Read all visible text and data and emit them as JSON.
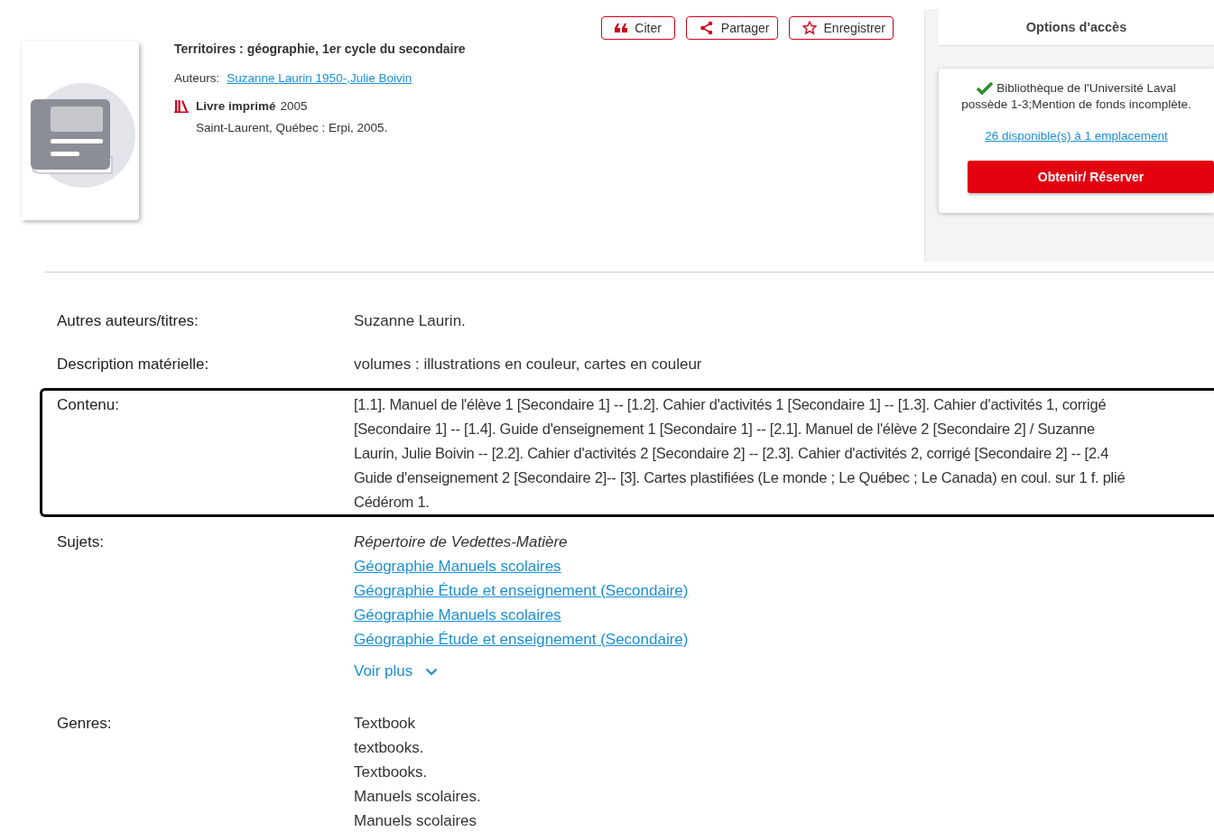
{
  "actions": [
    {
      "kind": "cite",
      "label": "Citer"
    },
    {
      "kind": "share",
      "label": "Partager"
    },
    {
      "kind": "save",
      "label": "Enregistrer"
    }
  ],
  "record": {
    "title": "Territoires : géographie, 1er cycle du secondaire",
    "authors_label": "Auteurs:",
    "authors": [
      "Suzanne Laurin 1950-",
      "Julie Boivin"
    ],
    "author_separator": ",",
    "format": "Livre imprimé",
    "year": "2005",
    "publication": "Saint-Laurent, Québec : Erpi, 2005."
  },
  "access": {
    "title": "Options d'accès",
    "library": "Bibliothèque de l'Université Laval",
    "holdings": "possède 1-3;Mention de fonds incomplète.",
    "availability": "26 disponible(s) à 1 emplacement",
    "button": "Obtenir/ Réserver"
  },
  "details": [
    {
      "label": "Autres auteurs/titres:",
      "highlighted": false,
      "items": [
        {
          "kind": "text",
          "text": "Suzanne Laurin."
        }
      ]
    },
    {
      "label": "Description matérielle:",
      "highlighted": false,
      "items": [
        {
          "kind": "text",
          "text": "volumes : illustrations en couleur, cartes en couleur"
        }
      ]
    },
    {
      "label": "Contenu:",
      "highlighted": true,
      "items": [
        {
          "kind": "paragraph",
          "lines": [
            "[1.1]. Manuel de l'élève 1 [Secondaire 1] -- [1.2]. Cahier d'activités 1 [Secondaire 1] -- [1.3]. Cahier d'activités 1, corrigé",
            "[Secondaire 1] -- [1.4]. Guide d'enseignement 1 [Secondaire 1] -- [2.1]. Manuel de l'élève 2 [Secondaire 2] / Suzanne",
            "Laurin, Julie Boivin -- [2.2]. Cahier d'activités 2 [Secondaire 2] -- [2.3]. Cahier d'activités 2, corrigé [Secondaire 2] -- [2.4",
            "Guide d'enseignement 2 [Secondaire 2]-- [3]. Cartes plastifiées (Le monde ; Le Québec ; Le Canada) en coul. sur 1 f. plié",
            "Cédérom 1."
          ]
        }
      ]
    },
    {
      "label": "Sujets:",
      "highlighted": false,
      "items": [
        {
          "kind": "heading",
          "text": "Répertoire de Vedettes-Matière"
        },
        {
          "kind": "link",
          "text": "Géographie Manuels scolaires"
        },
        {
          "kind": "link",
          "text": "Géographie Étude et enseignement (Secondaire)"
        },
        {
          "kind": "link",
          "text": "Géographie Manuels scolaires"
        },
        {
          "kind": "link",
          "text": "Géographie Étude et enseignement (Secondaire)"
        },
        {
          "kind": "more",
          "text": "Voir plus"
        }
      ]
    },
    {
      "label": "Genres:",
      "highlighted": false,
      "items": [
        {
          "kind": "text",
          "text": "Textbook"
        },
        {
          "kind": "text",
          "text": "textbooks."
        },
        {
          "kind": "text",
          "text": "Textbooks."
        },
        {
          "kind": "text",
          "text": "Manuels scolaires."
        },
        {
          "kind": "text",
          "text": "Manuels scolaires"
        }
      ]
    }
  ]
}
